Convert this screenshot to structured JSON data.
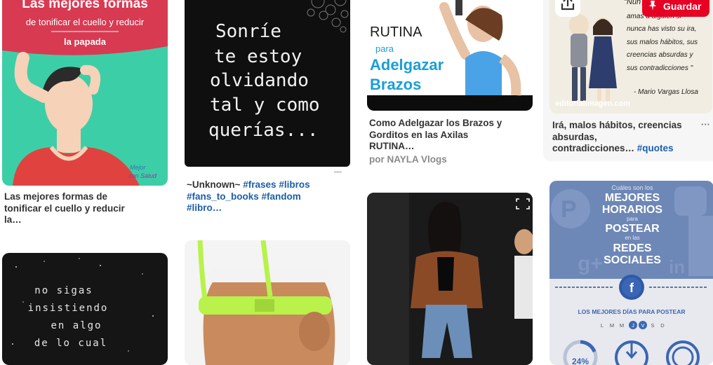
{
  "pins": {
    "neck": {
      "image": {
        "title": "Las mejores formas",
        "subtitle": "de tonificar el cuello y reducir",
        "subtitle2": "la papada",
        "logo1": "Mejor",
        "logo2": "con Salud"
      },
      "caption": [
        "Las mejores formas de",
        "tonificar el cuello y reducir",
        "la…"
      ]
    },
    "quote": {
      "image": {
        "lines": [
          "Sonríe",
          "te estoy",
          "olvidando",
          "tal y como",
          "querías..."
        ]
      },
      "caption_line1_text": "~Unknown~ ",
      "caption_tags": [
        "#frases",
        "#libros",
        "#fans_to_books",
        "#fandom",
        "#libro…"
      ]
    },
    "arms": {
      "image": {
        "line1": "RUTINA",
        "line2": "para",
        "line3": "Adelgazar",
        "line4": "Brazos"
      },
      "caption": [
        "Como Adelgazar los Brazos y",
        "Gorditos en las Axilas",
        "RUTINA…"
      ],
      "source": "por NAYLA Vlogs"
    },
    "vargas": {
      "save_label": "Guardar",
      "image": {
        "quote_lines": [
          "\"Nun",
          "amas a alguien si",
          "nunca has visto su ira,",
          "sus malos hábitos, sus",
          "creencias absurdas y",
          "sus contradicciones \""
        ],
        "author": "- Mario Vargas Llosa",
        "watermark": "editorialimagen.com"
      },
      "caption_lines": [
        "Irá, malos hábitos, creencias",
        "absurdas,"
      ],
      "caption_last_text": "contradicciones… ",
      "caption_tag": "#quotes",
      "more": "···"
    },
    "stars": {
      "image": {
        "lines": [
          "no sigas",
          "insistiendo",
          "en algo",
          "de lo cual"
        ]
      }
    },
    "bra": {},
    "kylie": {},
    "social": {
      "image": {
        "l1": "Cuáles son los",
        "l2": "MEJORES",
        "l3": "HORARIOS",
        "l4": "para",
        "l5": "POSTEAR",
        "l6": "en las",
        "l7": "REDES",
        "l8": "SOCIALES",
        "days_title": "LOS MEJORES DÍAS PARA POSTEAR",
        "days": [
          "L",
          "M",
          "M",
          "J",
          "V",
          "S",
          "D"
        ],
        "fb": "f",
        "pct": "24%"
      }
    }
  },
  "colors": {
    "pinterest_red": "#e60023",
    "tag_blue": "#1a5fa8"
  }
}
